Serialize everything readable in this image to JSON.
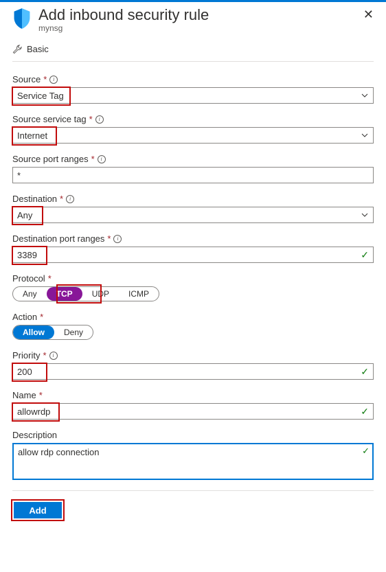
{
  "header": {
    "title": "Add inbound security rule",
    "subtitle": "mynsg"
  },
  "toolbar": {
    "basic": "Basic"
  },
  "fields": {
    "source": {
      "label": "Source",
      "value": "Service Tag"
    },
    "source_service_tag": {
      "label": "Source service tag",
      "value": "Internet"
    },
    "source_port_ranges": {
      "label": "Source port ranges",
      "value": "*"
    },
    "destination": {
      "label": "Destination",
      "value": "Any"
    },
    "destination_port_ranges": {
      "label": "Destination port ranges",
      "value": "3389"
    },
    "protocol": {
      "label": "Protocol",
      "options": [
        "Any",
        "TCP",
        "UDP",
        "ICMP"
      ],
      "selected": "TCP"
    },
    "action": {
      "label": "Action",
      "options": [
        "Allow",
        "Deny"
      ],
      "selected": "Allow"
    },
    "priority": {
      "label": "Priority",
      "value": "200"
    },
    "name": {
      "label": "Name",
      "value": "allowrdp"
    },
    "description": {
      "label": "Description",
      "value": "allow rdp connection"
    }
  },
  "footer": {
    "add": "Add"
  },
  "asterisk": "*"
}
